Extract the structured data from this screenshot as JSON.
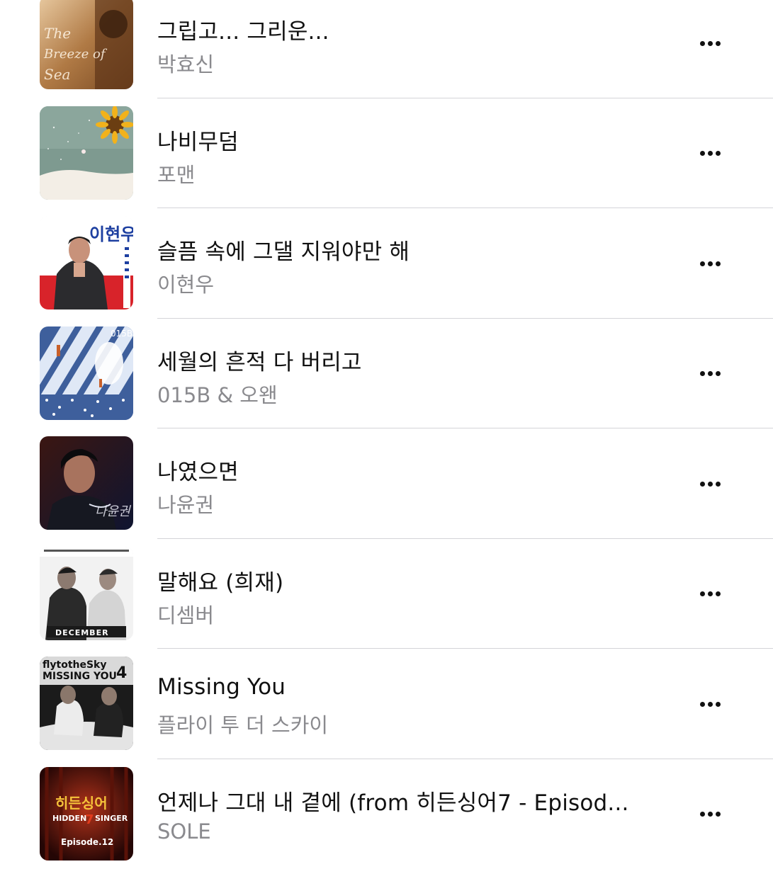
{
  "songs": [
    {
      "title": "그립고... 그리운...",
      "artist": "박효신",
      "art_text": "THE BREEZE OF SEA · THE BALLAD PARK, HYOSHIN",
      "art_icon": "album-art-breeze-of-sea"
    },
    {
      "title": "나비무덤",
      "artist": "포맨",
      "art_text": "",
      "art_icon": "album-art-sunflower-snow"
    },
    {
      "title": "슬픔 속에 그댈 지워야만 해",
      "artist": "이현우",
      "art_text": "이현우",
      "art_icon": "album-art-portrait-red"
    },
    {
      "title": "세월의 흔적 다 버리고",
      "artist": "015B & 오왠",
      "art_text": "015B",
      "art_icon": "album-art-blue-stripes"
    },
    {
      "title": "나였으면",
      "artist": "나윤권",
      "art_text": "",
      "art_icon": "album-art-portrait-dark"
    },
    {
      "title": "말해요 (희재)",
      "artist": "디셈버",
      "art_text": "DECEMBER",
      "art_icon": "album-art-duo-bw"
    },
    {
      "title": "Missing You",
      "artist": "플라이 투 더 스카이",
      "art_text": "MISSING YOU 4",
      "art_icon": "album-art-duo-sofa"
    },
    {
      "title": "언제나 그대 내 곁에 (from 히든싱어7 - Episod...",
      "artist": "SOLE",
      "art_text": "HIDDEN 7 SINGER · Episode.12",
      "art_icon": "album-art-hidden-singer"
    }
  ],
  "more_label": "More options",
  "colors": {
    "title": "#111111",
    "artist": "#8a8a8e",
    "separator": "#d4d4d8"
  }
}
